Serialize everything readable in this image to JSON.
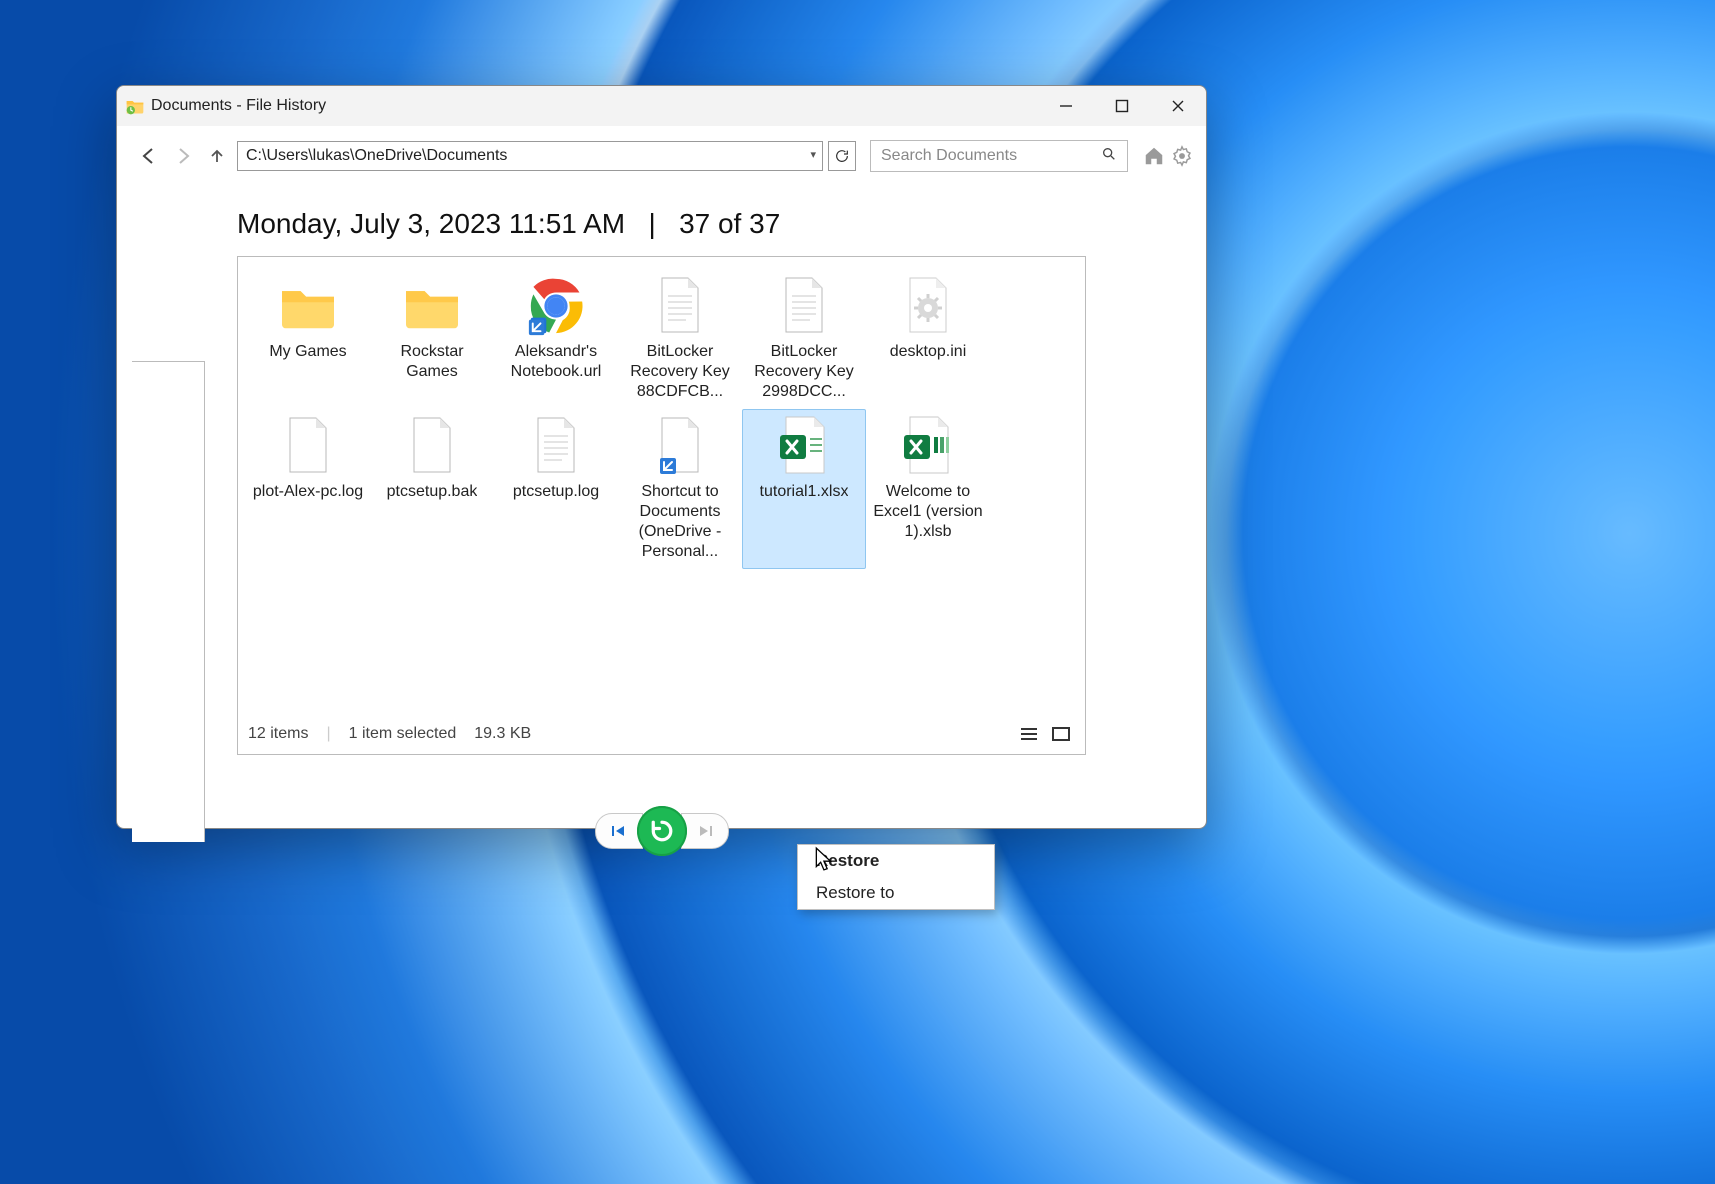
{
  "window": {
    "title": "Documents - File History",
    "address": "C:\\Users\\lukas\\OneDrive\\Documents",
    "search_placeholder": "Search Documents"
  },
  "dateline": {
    "date": "Monday, July 3, 2023 11:51 AM",
    "separator": "|",
    "counter": "37 of 37"
  },
  "files": [
    {
      "name": "My Games",
      "type": "folder",
      "selected": false
    },
    {
      "name": "Rockstar Games",
      "type": "folder",
      "selected": false
    },
    {
      "name": "Aleksandr's Notebook.url",
      "type": "chrome",
      "selected": false
    },
    {
      "name": "BitLocker Recovery Key 88CDFCB...",
      "type": "text",
      "selected": false
    },
    {
      "name": "BitLocker Recovery Key 2998DCC...",
      "type": "text",
      "selected": false
    },
    {
      "name": "desktop.ini",
      "type": "ini",
      "selected": false
    },
    {
      "name": "plot-Alex-pc.log",
      "type": "blank",
      "selected": false
    },
    {
      "name": "ptcsetup.bak",
      "type": "blank",
      "selected": false
    },
    {
      "name": "ptcsetup.log",
      "type": "text",
      "selected": false
    },
    {
      "name": "Shortcut to Documents (OneDrive - Personal...",
      "type": "shortcut",
      "selected": false
    },
    {
      "name": "tutorial1.xlsx",
      "type": "excel",
      "selected": true
    },
    {
      "name": "Welcome to Excel1 (version 1).xlsb",
      "type": "excel2",
      "selected": false
    }
  ],
  "status": {
    "count": "12 items",
    "selection": "1 item selected",
    "size": "19.3 KB"
  },
  "context_menu": {
    "restore": "Restore",
    "restore_to": "Restore to"
  }
}
